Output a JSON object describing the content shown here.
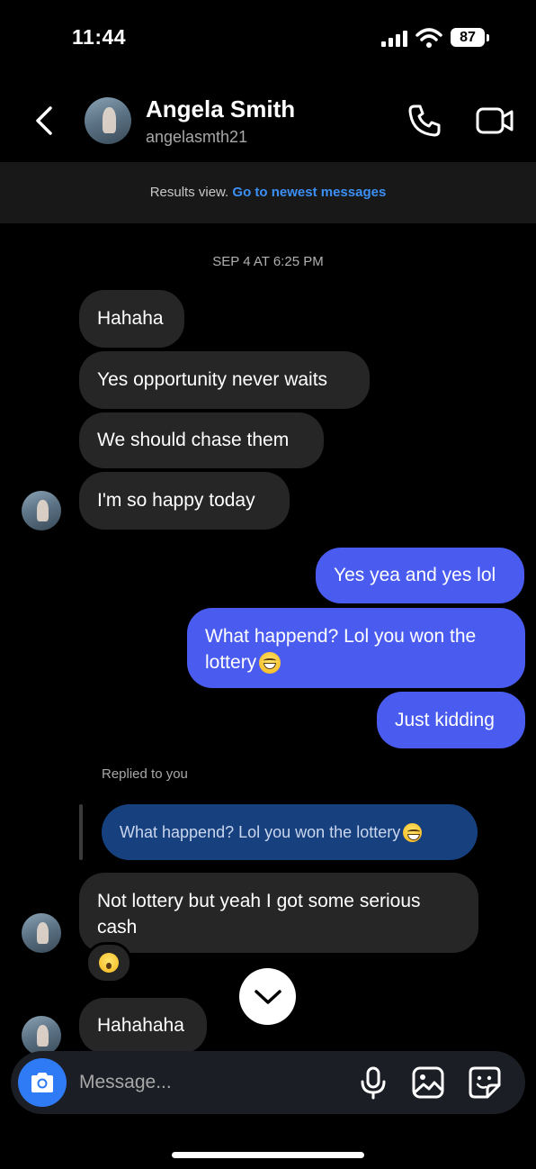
{
  "status_bar": {
    "time": "11:44",
    "battery": "87"
  },
  "header": {
    "name": "Angela Smith",
    "handle": "angelasmth21"
  },
  "banner": {
    "text": "Results view.",
    "link": "Go to newest messages"
  },
  "timestamp": "SEP 4 AT 6:25 PM",
  "messages_in_1": [
    "Hahaha",
    "Yes opportunity never waits",
    "We should chase them",
    "I'm so happy today"
  ],
  "messages_out": {
    "m1": "Yes yea and yes lol",
    "m2_line1": "What happend? Lol you won the",
    "m2_line2": "lottery",
    "m3": "Just kidding"
  },
  "reply": {
    "label": "Replied to you",
    "quoted": "What happend? Lol you won the lottery",
    "message_line1": "Not lottery but yeah I got some serious",
    "message_line2": "cash",
    "reaction": "😮"
  },
  "last_message": "Hahahaha",
  "composer": {
    "placeholder": "Message..."
  },
  "colors": {
    "outgoing": "#4a5cf0",
    "incoming": "#262626",
    "link": "#3b8ff5",
    "reply_quote": "#17407f"
  }
}
